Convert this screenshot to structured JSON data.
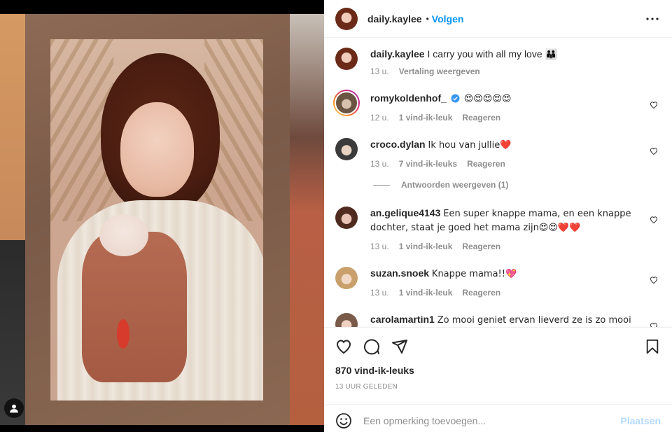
{
  "post": {
    "author": "daily.kaylee",
    "follow_label": "Volgen",
    "separator": "•",
    "caption_user": "daily.kaylee",
    "caption_text": "I carry you with all my love 👪",
    "caption_time": "13 u.",
    "caption_translate": "Vertaling weergeven"
  },
  "comments": [
    {
      "user": "romykoldenhof_",
      "verified": true,
      "text": "😍😍😍😍😍",
      "time": "12 u.",
      "likes": "1 vind-ik-leuk",
      "reply": "Reageren"
    },
    {
      "user": "croco.dylan",
      "text": "Ik hou van jullie❤️",
      "time": "13 u.",
      "likes": "7 vind-ik-leuks",
      "reply": "Reageren",
      "view_replies": "Antwoorden weergeven (1)"
    },
    {
      "user": "an.gelique4143",
      "text": "Een super knappe mama, en een knappe dochter, staat je goed het mama zijn😍😍❤️❤️",
      "time": "13 u.",
      "likes": "1 vind-ik-leuk",
      "reply": "Reageren"
    },
    {
      "user": "suzan.snoek",
      "text": "Knappe mama!!💖",
      "time": "13 u.",
      "likes": "1 vind-ik-leuk",
      "reply": "Reageren"
    },
    {
      "user": "carolamartin1",
      "text": "Zo mooi geniet ervan lieverd ze is zo mooi ❤️"
    }
  ],
  "engagement": {
    "likes": "870 vind-ik-leuks",
    "time_ago": "13 UUR GELEDEN"
  },
  "composer": {
    "placeholder": "Een opmerking toevoegen...",
    "post_label": "Plaatsen"
  },
  "colors": {
    "accent": "#0095f6",
    "muted": "#8e8e8e",
    "post_disabled": "#b3dbff",
    "verified": "#3897f0"
  },
  "icons": [
    "user-tag-icon",
    "more-icon",
    "heart-icon",
    "comment-icon",
    "share-icon",
    "bookmark-icon",
    "smile-icon",
    "verified-icon"
  ]
}
